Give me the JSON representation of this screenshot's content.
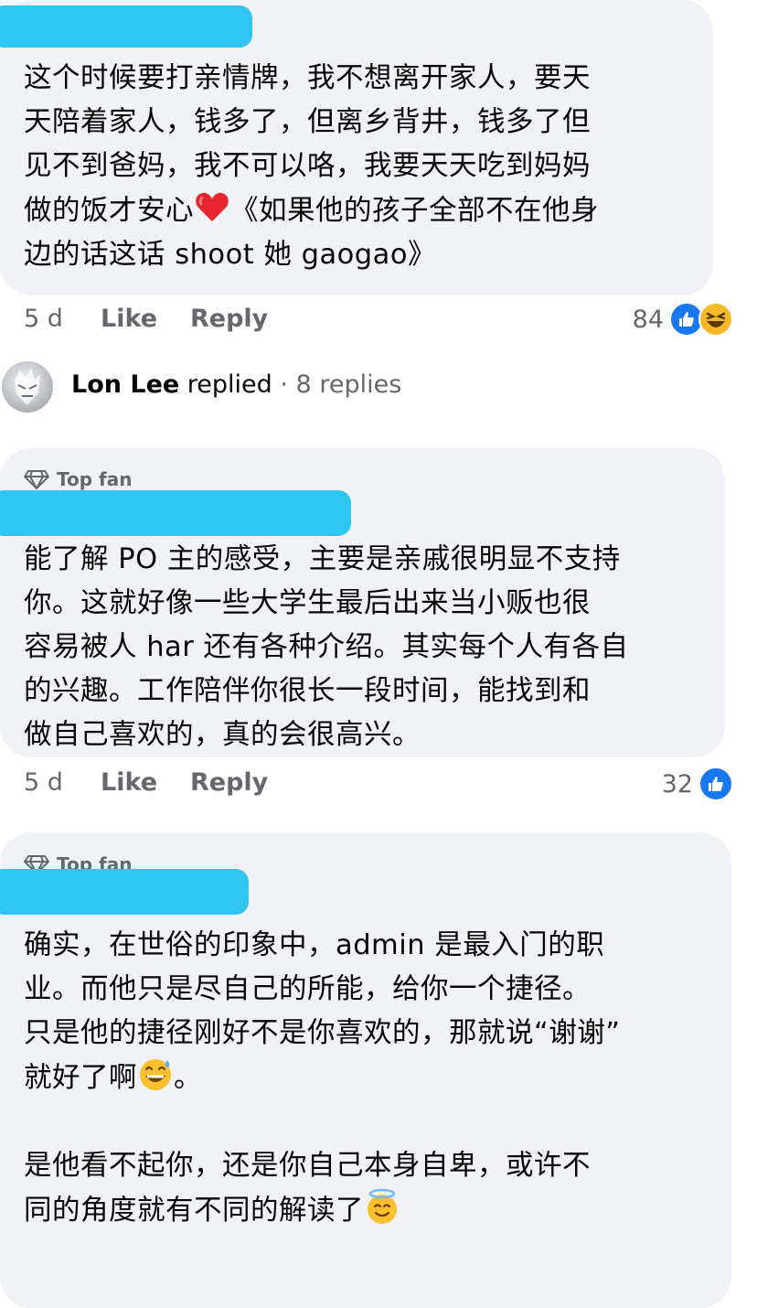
{
  "comments": [
    {
      "text": "这个时候要打亲情牌，我不想离开家人，要天\n天陪着家人，钱多了，但离乡背井，钱多了但\n见不到爸妈，我不可以咯，我要天天吃到妈妈\n做的饭才安心",
      "text_after_emoji": "《如果他的孩子全部不在他身\n边的话这话 shoot 她 gaogao》",
      "emoji": "red-heart",
      "time": "5 d",
      "like_label": "Like",
      "reply_label": "Reply",
      "reaction_count": "84",
      "reactions": [
        "like",
        "haha"
      ]
    },
    {
      "badge": "Top fan",
      "text": "能了解 PO 主的感受，主要是亲戚很明显不支持\n你。这就好像一些大学生最后出来当小贩也很\n容易被人 har 还有各种介绍。其实每个人有各自\n的兴趣。工作陪伴你很长一段时间，能找到和\n做自己喜欢的，真的会很高兴。",
      "time": "5 d",
      "like_label": "Like",
      "reply_label": "Reply",
      "reaction_count": "32",
      "reactions": [
        "like"
      ]
    },
    {
      "badge": "Top fan",
      "text": "确实，在世俗的印象中，admin 是最入门的职\n业。而他只是尽自己的所能，给你一个捷径。\n只是他的捷径刚好不是你喜欢的，那就说“谢谢”",
      "line4": "就好了啊",
      "line4_after": "。",
      "text2": "是他看不起你，还是你自己本身自卑，或许不",
      "line7": "同的角度就有不同的解读了"
    }
  ],
  "replied": {
    "name": "Lon Lee",
    "action": " replied",
    "count": " · 8 replies"
  },
  "colors": {
    "bubble": "#f0f2f5",
    "meta": "#65676b",
    "like_blue": "#1877f2",
    "redaction": "#2ec5f0"
  }
}
